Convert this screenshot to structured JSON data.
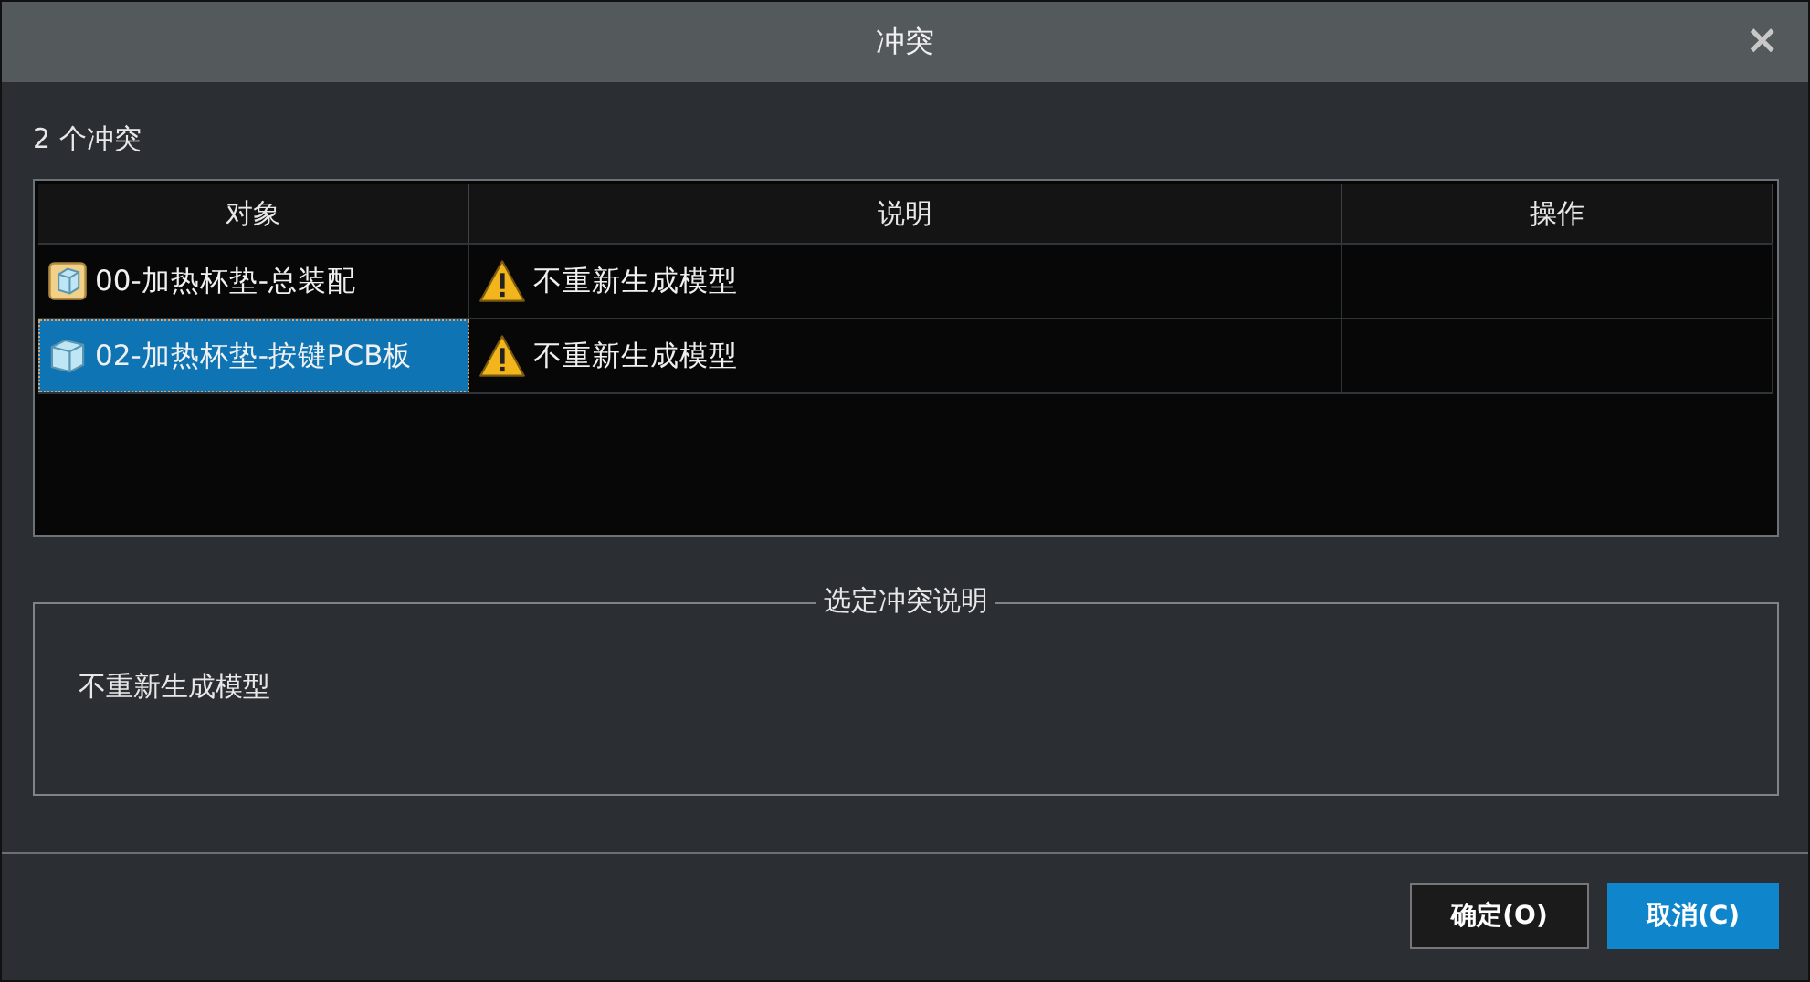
{
  "window": {
    "title": "冲突",
    "close": "×"
  },
  "count_label": "2 个冲突",
  "table": {
    "columns": [
      "对象",
      "说明",
      "操作"
    ],
    "rows": [
      {
        "object": "00-加热杯垫-总装配",
        "kind": "assembly",
        "description": "不重新生成模型",
        "selected": false
      },
      {
        "object": "02-加热杯垫-按键PCB板",
        "kind": "part",
        "description": "不重新生成模型",
        "selected": true
      }
    ]
  },
  "details": {
    "legend": "选定冲突说明",
    "text": "不重新生成模型"
  },
  "buttons": [
    {
      "label": "确定(O)",
      "primary": false
    },
    {
      "label": "取消(C)",
      "primary": true
    }
  ]
}
